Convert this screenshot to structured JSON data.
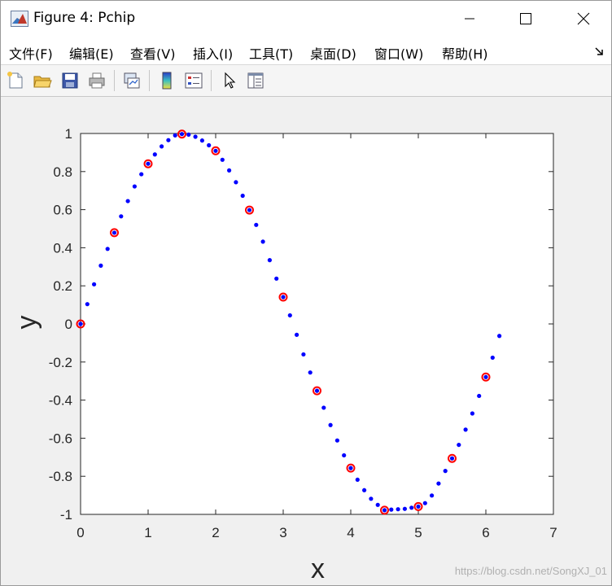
{
  "window": {
    "title": "Figure 4: Pchip",
    "controls": {
      "minimize": "minimize",
      "maximize": "maximize",
      "close": "close"
    }
  },
  "menu": {
    "items": [
      "文件(F)",
      "编辑(E)",
      "查看(V)",
      "插入(I)",
      "工具(T)",
      "桌面(D)",
      "窗口(W)",
      "帮助(H)"
    ]
  },
  "toolbar": {
    "buttons": [
      "new-figure-icon",
      "open-file-icon",
      "save-icon",
      "print-icon",
      "link-plot-icon",
      "insert-colorbar-icon",
      "insert-legend-icon",
      "edit-plot-icon",
      "property-inspector-icon"
    ]
  },
  "chart_data": {
    "type": "scatter",
    "xlabel": "x",
    "ylabel": "y",
    "xlim": [
      0,
      7
    ],
    "ylim": [
      -1,
      1
    ],
    "xticks": [
      0,
      1,
      2,
      3,
      4,
      5,
      6,
      7
    ],
    "yticks": [
      -1,
      -0.8,
      -0.6,
      -0.4,
      -0.2,
      0,
      0.2,
      0.4,
      0.6,
      0.8,
      1
    ],
    "ytick_labels": [
      "-1",
      "-0.8",
      "-0.6",
      "-0.4",
      "-0.2",
      "0",
      "0.2",
      "0.4",
      "0.6",
      "0.8",
      "1"
    ],
    "xtick_labels": [
      "0",
      "1",
      "2",
      "3",
      "4",
      "5",
      "6",
      "7"
    ],
    "grid": false,
    "series": [
      {
        "marker": "circle-open",
        "color": "#ff0000",
        "x": [
          0,
          0.5,
          1,
          1.5,
          2,
          2.5,
          3,
          3.5,
          4,
          4.5,
          5,
          5.5,
          6
        ],
        "y": [
          0,
          0.479,
          0.841,
          0.997,
          0.909,
          0.598,
          0.141,
          -0.351,
          -0.757,
          -0.978,
          -0.959,
          -0.706,
          -0.279
        ]
      },
      {
        "marker": "dot",
        "color": "#0000ff",
        "x": [
          0,
          0.1,
          0.2,
          0.3,
          0.4,
          0.5,
          0.6,
          0.7,
          0.8,
          0.9,
          1.0,
          1.1,
          1.2,
          1.3,
          1.4,
          1.5,
          1.6,
          1.7,
          1.8,
          1.9,
          2.0,
          2.1,
          2.2,
          2.3,
          2.4,
          2.5,
          2.6,
          2.7,
          2.8,
          2.9,
          3.0,
          3.1,
          3.2,
          3.3,
          3.4,
          3.5,
          3.6,
          3.7,
          3.8,
          3.9,
          4.0,
          4.1,
          4.2,
          4.3,
          4.4,
          4.5,
          4.6,
          4.7,
          4.8,
          4.9,
          5.0,
          5.1,
          5.2,
          5.3,
          5.4,
          5.5,
          5.6,
          5.7,
          5.8,
          5.9,
          6.0,
          6.1,
          6.2
        ],
        "y": [
          0,
          0.104,
          0.208,
          0.306,
          0.394,
          0.479,
          0.565,
          0.645,
          0.722,
          0.786,
          0.841,
          0.89,
          0.932,
          0.965,
          0.99,
          0.997,
          0.994,
          0.983,
          0.963,
          0.938,
          0.909,
          0.862,
          0.806,
          0.744,
          0.673,
          0.598,
          0.52,
          0.432,
          0.335,
          0.238,
          0.141,
          0.045,
          -0.057,
          -0.16,
          -0.255,
          -0.351,
          -0.44,
          -0.531,
          -0.612,
          -0.69,
          -0.757,
          -0.818,
          -0.873,
          -0.918,
          -0.95,
          -0.978,
          -0.975,
          -0.973,
          -0.971,
          -0.965,
          -0.959,
          -0.941,
          -0.901,
          -0.838,
          -0.772,
          -0.706,
          -0.635,
          -0.555,
          -0.47,
          -0.378,
          -0.279,
          -0.177,
          -0.063
        ]
      }
    ]
  },
  "watermark": "https://blog.csdn.net/SongXJ_01"
}
